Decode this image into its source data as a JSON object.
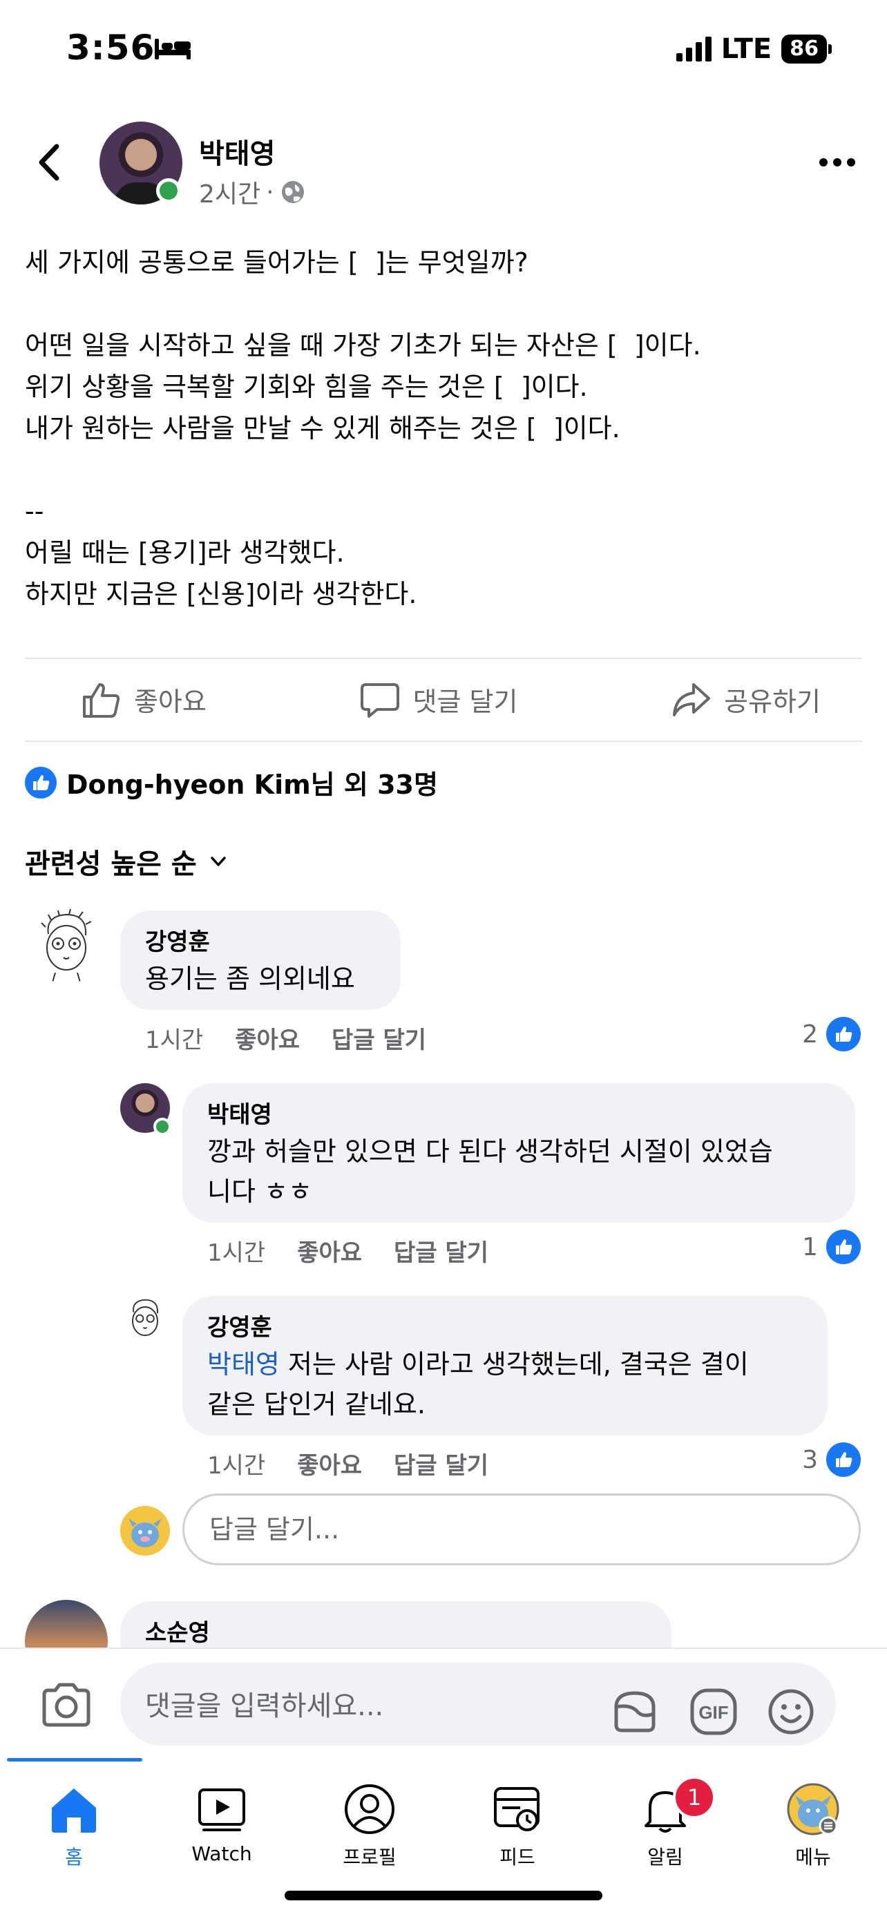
{
  "status_bar": {
    "time": "3:56",
    "network": "LTE",
    "battery": "86"
  },
  "post": {
    "author": "박태영",
    "time": "2시간",
    "separator": "·",
    "lines": [
      "세 가지에 공통으로 들어가는 [  ]는 무엇일까?",
      "",
      "어떤 일을 시작하고 싶을 때 가장 기초가 되는 자산은 [  ]이다.",
      "위기 상황을 극복할 기회와 힘을 주는 것은 [  ]이다.",
      "내가 원하는 사람을 만날 수 있게 해주는 것은 [  ]이다.",
      "",
      "--",
      "어릴 때는 [용기]라 생각했다.",
      "하지만 지금은 [신용]이라 생각한다."
    ]
  },
  "actions": {
    "like": "좋아요",
    "comment": "댓글 달기",
    "share": "공유하기"
  },
  "reactions": {
    "summary": "Dong-hyeon Kim님 외 33명"
  },
  "sort": {
    "label": "관련성 높은 순"
  },
  "comments": [
    {
      "name": "강영훈",
      "text": "용기는 좀 의외네요",
      "time": "1시간",
      "like": "좋아요",
      "reply": "답글 달기",
      "likes": "2"
    },
    {
      "name": "박태영",
      "text_line1": "깡과 허슬만 있으면 다 된다 생각하던 시절이 있었습",
      "text_line2": "니다 ㅎㅎ",
      "time": "1시간",
      "like": "좋아요",
      "reply": "답글 달기",
      "likes": "1"
    },
    {
      "name": "강영훈",
      "mention": "박태영",
      "text_line1": " 저는 사람 이라고 생각했는데, 결국은 결이",
      "text_line2": "같은 답인거 같네요.",
      "time": "1시간",
      "like": "좋아요",
      "reply": "답글 달기",
      "likes": "3"
    },
    {
      "name": "소순영"
    }
  ],
  "reply_input": {
    "placeholder": "답글 달기..."
  },
  "comment_bar": {
    "placeholder": "댓글을 입력하세요..."
  },
  "tabs": [
    {
      "label": "홈",
      "icon": "home-icon",
      "active": true
    },
    {
      "label": "Watch",
      "icon": "watch-icon"
    },
    {
      "label": "프로필",
      "icon": "profile-icon"
    },
    {
      "label": "피드",
      "icon": "feed-icon"
    },
    {
      "label": "알림",
      "icon": "bell-icon",
      "badge": "1"
    },
    {
      "label": "메뉴",
      "icon": "menu-avatar-icon"
    }
  ],
  "colors": {
    "accent": "#1877f2",
    "mention": "#1b5fc1",
    "online": "#31a24c",
    "badge": "#e41e3f",
    "bubble": "#f0f2f5"
  }
}
